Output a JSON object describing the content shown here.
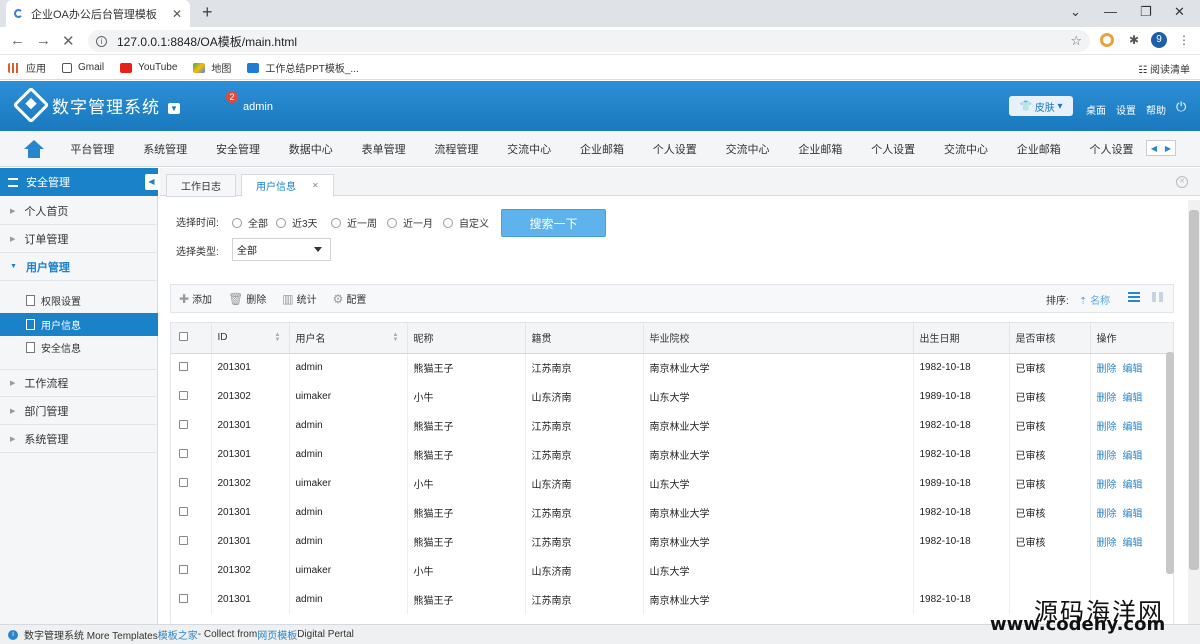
{
  "browser": {
    "tab_title": "企业OA办公后台管理模板",
    "url": "127.0.0.1:8848/OA模板/main.html",
    "profile_initial": "9",
    "bookmarks": [
      "应用",
      "Gmail",
      "YouTube",
      "地图",
      "工作总结PPT模板_..."
    ],
    "reading_list": "阅读清单"
  },
  "header": {
    "system_name": "数字管理系统",
    "notification_count": "2",
    "username": "admin",
    "skin_label": "皮肤",
    "links": [
      "桌面",
      "设置",
      "帮助"
    ]
  },
  "nav": {
    "items": [
      "平台管理",
      "系统管理",
      "安全管理",
      "数据中心",
      "表单管理",
      "流程管理",
      "交流中心",
      "企业邮箱",
      "个人设置",
      "交流中心",
      "企业邮箱",
      "个人设置",
      "交流中心",
      "企业邮箱",
      "个人设置"
    ]
  },
  "sidebar": {
    "title": "安全管理",
    "items": [
      "个人首页",
      "订单管理",
      "用户管理",
      "工作流程",
      "部门管理",
      "系统管理"
    ],
    "subitems": [
      "权限设置",
      "用户信息",
      "安全信息"
    ]
  },
  "tabs": [
    "工作日志",
    "用户信息"
  ],
  "filters": {
    "time_label": "选择时间:",
    "time_options": [
      "全部",
      "近3天",
      "近一周",
      "近一月",
      "自定义"
    ],
    "type_label": "选择类型:",
    "type_value": "全部",
    "search_button": "搜索一下"
  },
  "toolbar": {
    "add": "添加",
    "delete": "删除",
    "stats": "统计",
    "config": "配置",
    "sort_label": "排序:",
    "sort_field": "名称"
  },
  "table": {
    "columns": [
      "ID",
      "用户名",
      "昵称",
      "籍贯",
      "毕业院校",
      "出生日期",
      "是否审核",
      "操作"
    ],
    "action_delete": "删除",
    "action_edit": "编辑",
    "rows": [
      [
        "201301",
        "admin",
        "熊猫王子",
        "江苏南京",
        "南京林业大学",
        "1982-10-18",
        "已审核"
      ],
      [
        "201302",
        "uimaker",
        "小牛",
        "山东济南",
        "山东大学",
        "1989-10-18",
        "已审核"
      ],
      [
        "201301",
        "admin",
        "熊猫王子",
        "江苏南京",
        "南京林业大学",
        "1982-10-18",
        "已审核"
      ],
      [
        "201301",
        "admin",
        "熊猫王子",
        "江苏南京",
        "南京林业大学",
        "1982-10-18",
        "已审核"
      ],
      [
        "201302",
        "uimaker",
        "小牛",
        "山东济南",
        "山东大学",
        "1989-10-18",
        "已审核"
      ],
      [
        "201301",
        "admin",
        "熊猫王子",
        "江苏南京",
        "南京林业大学",
        "1982-10-18",
        "已审核"
      ],
      [
        "201301",
        "admin",
        "熊猫王子",
        "江苏南京",
        "南京林业大学",
        "1982-10-18",
        "已审核"
      ],
      [
        "201302",
        "uimaker",
        "小牛",
        "山东济南",
        "山东大学",
        "",
        ""
      ],
      [
        "201301",
        "admin",
        "熊猫王子",
        "江苏南京",
        "南京林业大学",
        "1982-10-18",
        ""
      ]
    ],
    "rows_with_actions": 7
  },
  "footer": {
    "text1": "数字管理系统 More Templates ",
    "link1": "模板之家",
    "text2": " - Collect from ",
    "link2": "网页模板",
    "text3": "Digital Pertal"
  },
  "watermark": {
    "line1": "源码海洋网",
    "line2": "www.codehy.com"
  },
  "colors": {
    "primary": "#1a82c8",
    "header_gradient_top": "#2c8fd5",
    "search_button": "#5fb3ec",
    "badge": "#e04a3a",
    "link": "#2a86cc"
  }
}
